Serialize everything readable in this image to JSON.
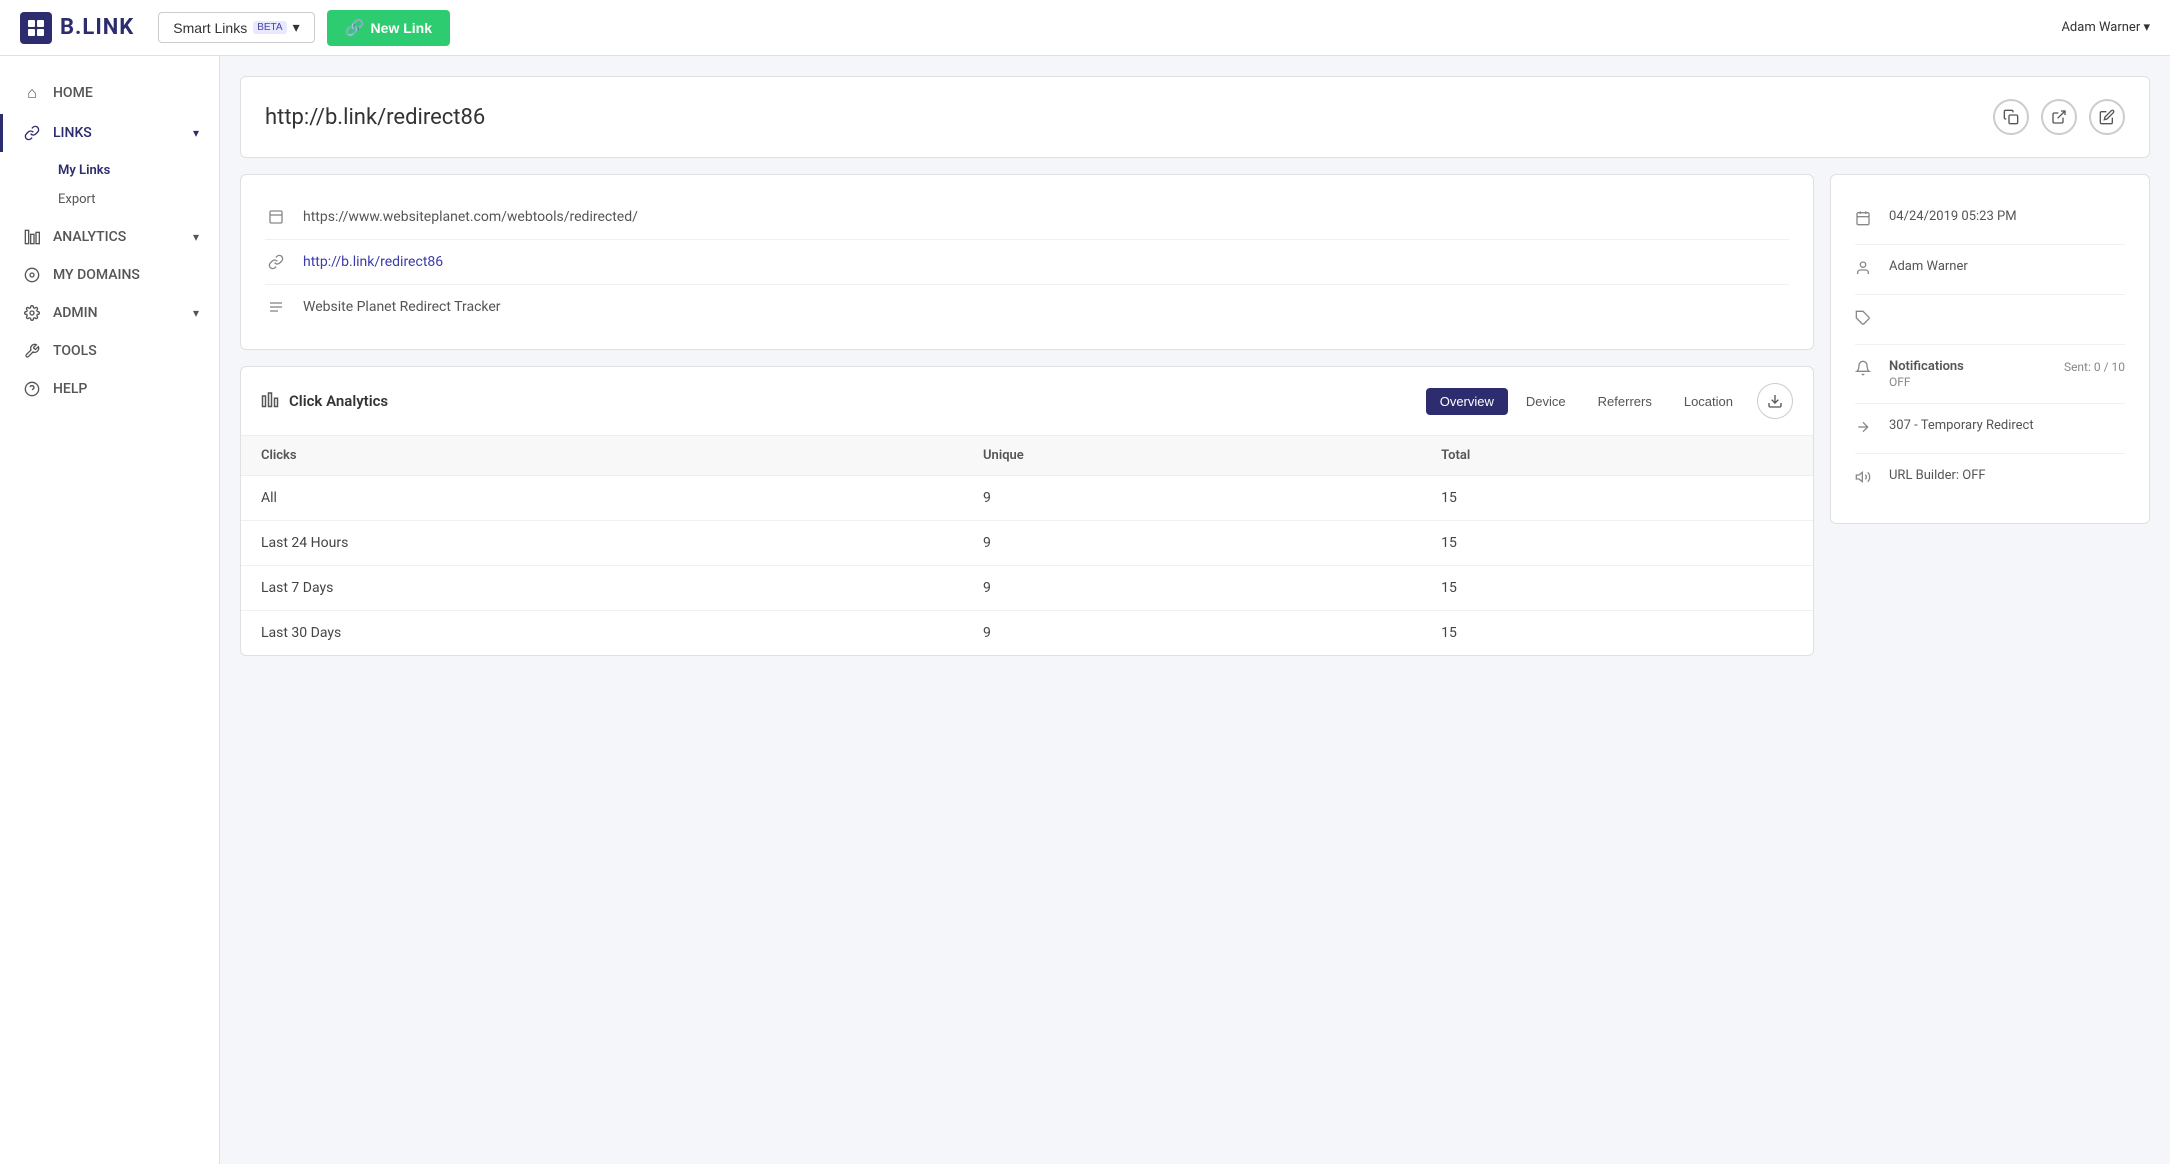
{
  "topnav": {
    "logo_text": "B.LINK",
    "smart_links_label": "Smart Links",
    "beta_label": "BETA",
    "new_link_label": "New Link",
    "user": "Adam Warner"
  },
  "sidebar": {
    "items": [
      {
        "id": "home",
        "label": "HOME",
        "icon": "⌂",
        "active": false
      },
      {
        "id": "links",
        "label": "LINKS",
        "icon": "🔗",
        "active": true,
        "chevron": "▾",
        "subitems": [
          {
            "id": "my-links",
            "label": "My Links",
            "active": true
          },
          {
            "id": "export",
            "label": "Export",
            "active": false
          }
        ]
      },
      {
        "id": "analytics",
        "label": "ANALYTICS",
        "icon": "📊",
        "active": false,
        "chevron": "▾"
      },
      {
        "id": "my-domains",
        "label": "MY DOMAINS",
        "icon": "○",
        "active": false
      },
      {
        "id": "admin",
        "label": "ADMIN",
        "icon": "⚙",
        "active": false,
        "chevron": "▾"
      },
      {
        "id": "tools",
        "label": "TOOLS",
        "icon": "🔧",
        "active": false
      },
      {
        "id": "help",
        "label": "HELP",
        "icon": "?",
        "active": false
      }
    ]
  },
  "page": {
    "url": "http://b.link/redirect86",
    "actions": [
      "copy",
      "external-link",
      "edit"
    ]
  },
  "link_info": {
    "destination_url": "https://www.websiteplanet.com/webtools/redirected/",
    "short_url": "http://b.link/redirect86",
    "title": "Website Planet Redirect Tracker"
  },
  "analytics": {
    "section_title": "Click Analytics",
    "tabs": [
      {
        "id": "overview",
        "label": "Overview",
        "active": true
      },
      {
        "id": "device",
        "label": "Device",
        "active": false
      },
      {
        "id": "referrers",
        "label": "Referrers",
        "active": false
      },
      {
        "id": "location",
        "label": "Location",
        "active": false
      }
    ],
    "table": {
      "columns": [
        "Clicks",
        "Unique",
        "Total"
      ],
      "rows": [
        {
          "label": "All",
          "unique": "9",
          "total": "15"
        },
        {
          "label": "Last 24 Hours",
          "unique": "9",
          "total": "15"
        },
        {
          "label": "Last 7 Days",
          "unique": "9",
          "total": "15"
        },
        {
          "label": "Last 30 Days",
          "unique": "9",
          "total": "15"
        }
      ]
    }
  },
  "right_panel": {
    "created_date": "04/24/2019 05:23 PM",
    "owner": "Adam Warner",
    "tags": "",
    "notifications_label": "Notifications",
    "notifications_status": "OFF",
    "notifications_sent": "Sent: 0 / 10",
    "redirect_type": "307 - Temporary Redirect",
    "url_builder": "URL Builder: OFF"
  }
}
